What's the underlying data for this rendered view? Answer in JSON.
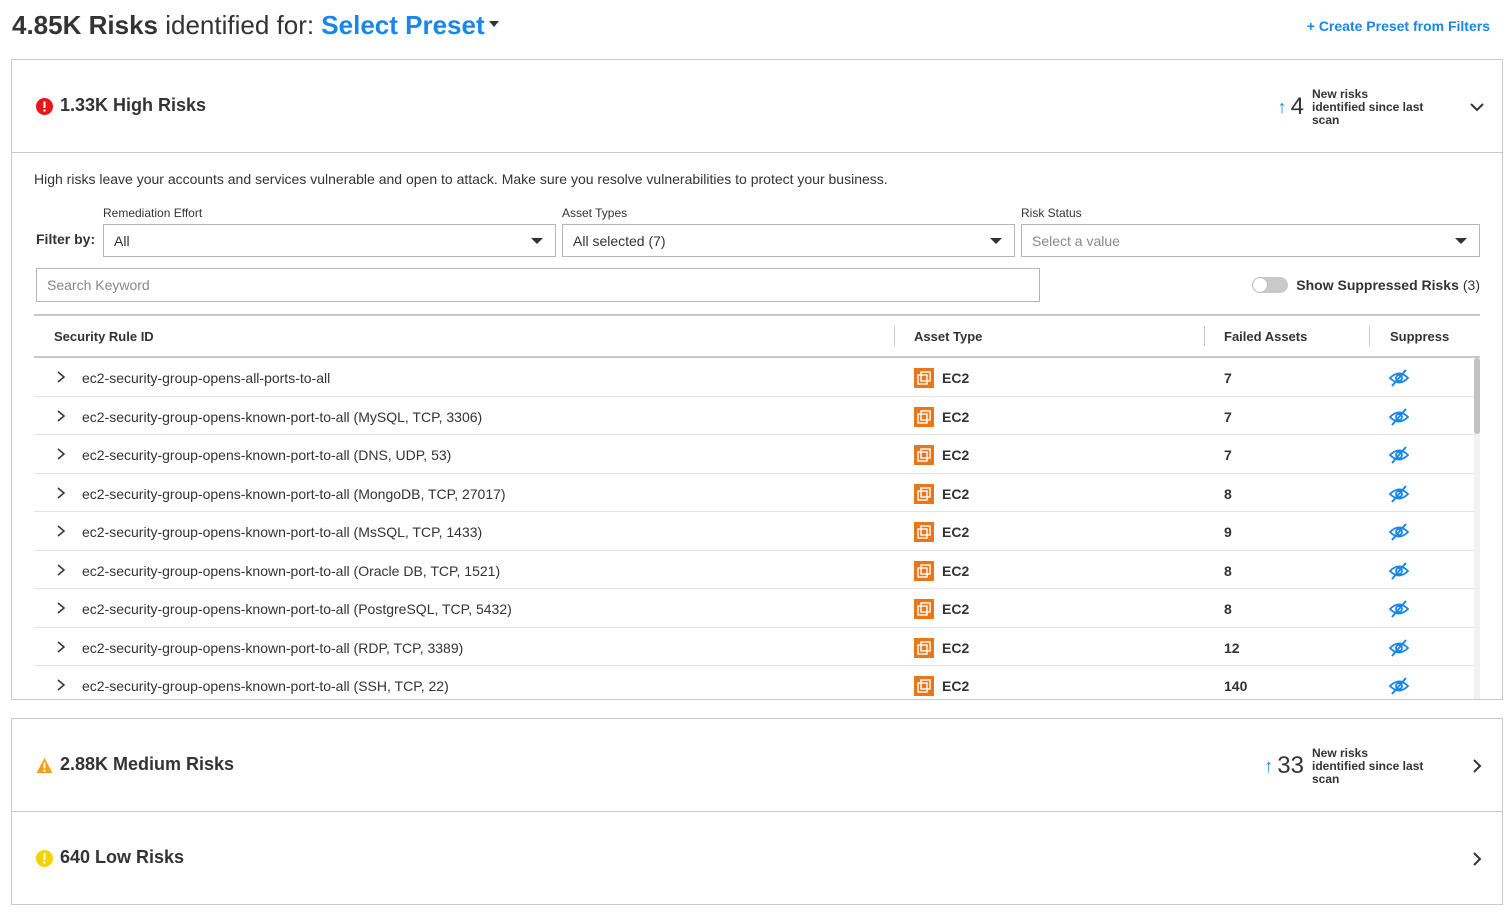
{
  "header": {
    "total_count": "4.85K Risks",
    "identified_text": " identified for: ",
    "preset_label": "Select Preset",
    "create_preset_label": "+ Create Preset from Filters"
  },
  "panels": {
    "high": {
      "title": "1.33K High Risks",
      "new_count": "4",
      "new_text": "New risks identified since last scan",
      "description": "High risks leave your accounts and services vulnerable and open to attack. Make sure you resolve vulnerabilities to protect your business.",
      "severity_color": "#e8151b"
    },
    "medium": {
      "title": "2.88K Medium Risks",
      "new_count": "33",
      "new_text": "New risks identified since last scan",
      "severity_color": "#f0a01a"
    },
    "low": {
      "title": "640 Low Risks",
      "severity_color": "#f5d300"
    }
  },
  "filters": {
    "filter_by_label": "Filter by:",
    "remediation": {
      "label": "Remediation Effort",
      "value": "All"
    },
    "asset_types": {
      "label": "Asset Types",
      "value": "All selected (7)"
    },
    "risk_status": {
      "label": "Risk Status",
      "placeholder": "Select a value"
    },
    "search_placeholder": "Search Keyword",
    "show_suppressed_label": "Show Suppressed Risks",
    "suppressed_count": "(3)"
  },
  "table": {
    "columns": [
      "Security Rule ID",
      "Asset Type",
      "Failed Assets",
      "Suppress"
    ],
    "rows": [
      {
        "rule": "ec2-security-group-opens-all-ports-to-all",
        "asset": "EC2",
        "failed": "7"
      },
      {
        "rule": "ec2-security-group-opens-known-port-to-all (MySQL, TCP, 3306)",
        "asset": "EC2",
        "failed": "7"
      },
      {
        "rule": "ec2-security-group-opens-known-port-to-all (DNS, UDP, 53)",
        "asset": "EC2",
        "failed": "7"
      },
      {
        "rule": "ec2-security-group-opens-known-port-to-all (MongoDB, TCP, 27017)",
        "asset": "EC2",
        "failed": "8"
      },
      {
        "rule": "ec2-security-group-opens-known-port-to-all (MsSQL, TCP, 1433)",
        "asset": "EC2",
        "failed": "9"
      },
      {
        "rule": "ec2-security-group-opens-known-port-to-all (Oracle DB, TCP, 1521)",
        "asset": "EC2",
        "failed": "8"
      },
      {
        "rule": "ec2-security-group-opens-known-port-to-all (PostgreSQL, TCP, 5432)",
        "asset": "EC2",
        "failed": "8"
      },
      {
        "rule": "ec2-security-group-opens-known-port-to-all (RDP, TCP, 3389)",
        "asset": "EC2",
        "failed": "12"
      },
      {
        "rule": "ec2-security-group-opens-known-port-to-all (SSH, TCP, 22)",
        "asset": "EC2",
        "failed": "140"
      }
    ]
  },
  "colors": {
    "accent": "#1a86e8",
    "ec2_orange": "#e8761b"
  },
  "icons": {
    "row_expand": "chevron-right-icon",
    "asset": "ec2-icon",
    "suppress": "eye-slash-icon"
  }
}
